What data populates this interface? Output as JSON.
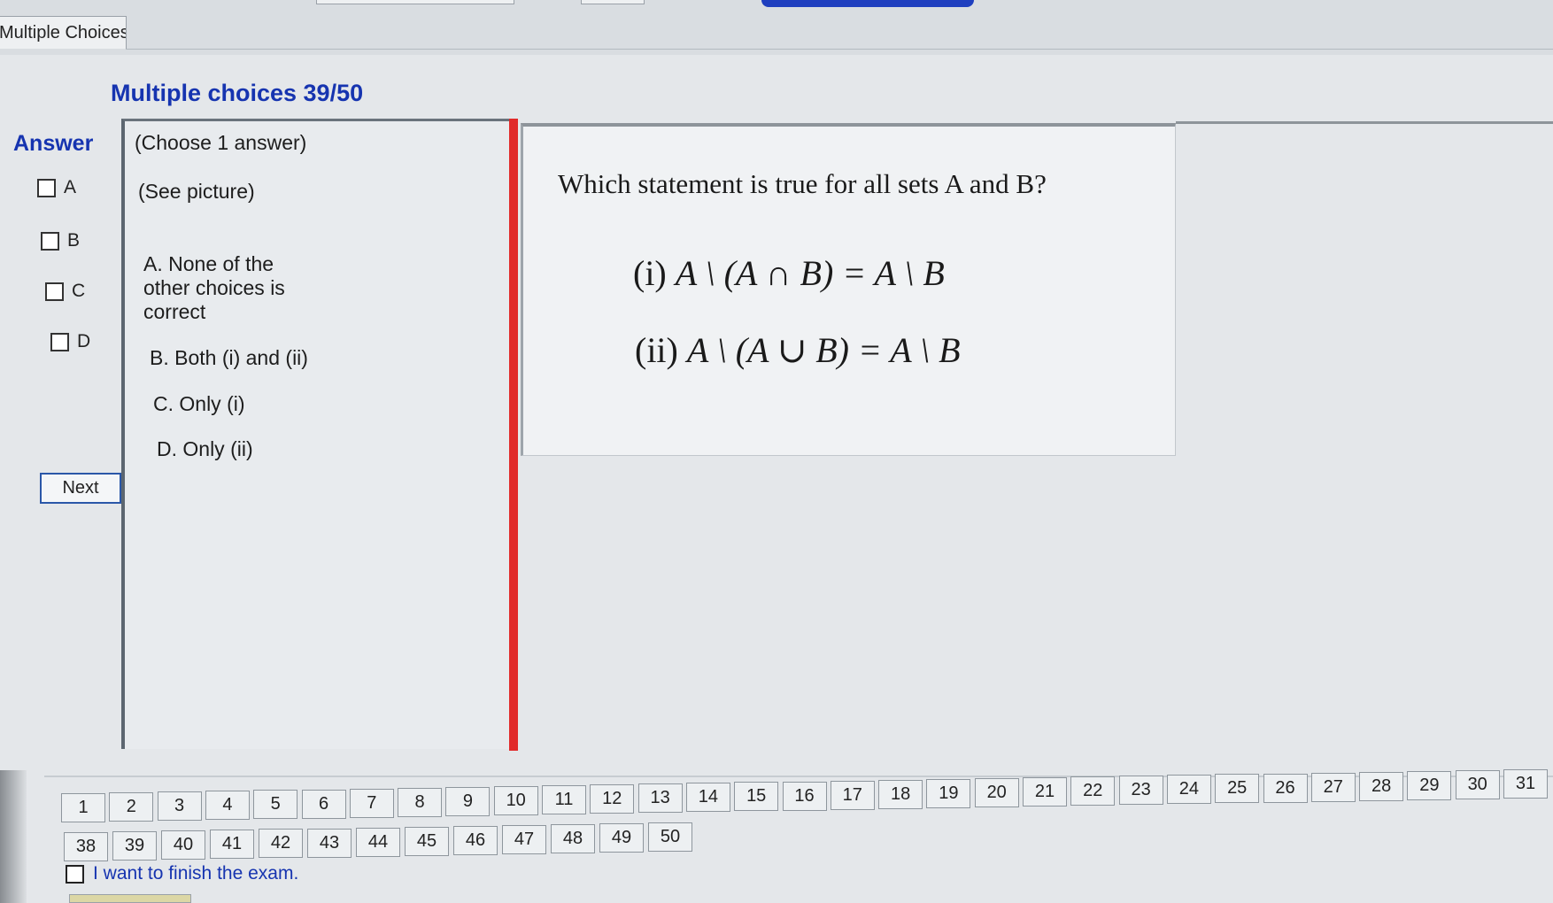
{
  "window": {
    "tab_label": "Multiple Choices"
  },
  "quiz": {
    "title": "Multiple choices 39/50"
  },
  "answer": {
    "heading": "Answer",
    "options": [
      {
        "label": "A",
        "checked": false
      },
      {
        "label": "B",
        "checked": false
      },
      {
        "label": "C",
        "checked": false
      },
      {
        "label": "D",
        "checked": false
      }
    ],
    "next_label": "Next"
  },
  "choices": {
    "instruction": "(Choose 1 answer)",
    "see_picture": "(See picture)",
    "items": [
      {
        "line1": "A.  None of the",
        "line2": "other choices is",
        "line3": "correct"
      },
      {
        "line1": "B.  Both (i) and (ii)"
      },
      {
        "line1": "C.  Only (i)"
      },
      {
        "line1": "D.  Only (ii)"
      }
    ]
  },
  "question": {
    "text": "Which statement is true for all sets A and B?",
    "statements": [
      {
        "label": "(i)",
        "lhs": "A \\ (A ∩ B) = A \\ B"
      },
      {
        "label": "(ii)",
        "lhs": "A \\ (A ∪ B) = A \\ B"
      }
    ]
  },
  "navigation": {
    "row1": [
      "1",
      "2",
      "3",
      "4",
      "5",
      "6",
      "7",
      "8",
      "9",
      "10",
      "11",
      "12",
      "13",
      "14",
      "15",
      "16",
      "17",
      "18",
      "19",
      "20",
      "21",
      "22",
      "23",
      "24",
      "25",
      "26",
      "27",
      "28",
      "29",
      "30",
      "31"
    ],
    "row2": [
      "38",
      "39",
      "40",
      "41",
      "42",
      "43",
      "44",
      "45",
      "46",
      "47",
      "48",
      "49",
      "50"
    ],
    "finish_label": "I want to finish the exam."
  },
  "colors": {
    "accent": "#1634b0",
    "divider": "#e12a2a"
  }
}
